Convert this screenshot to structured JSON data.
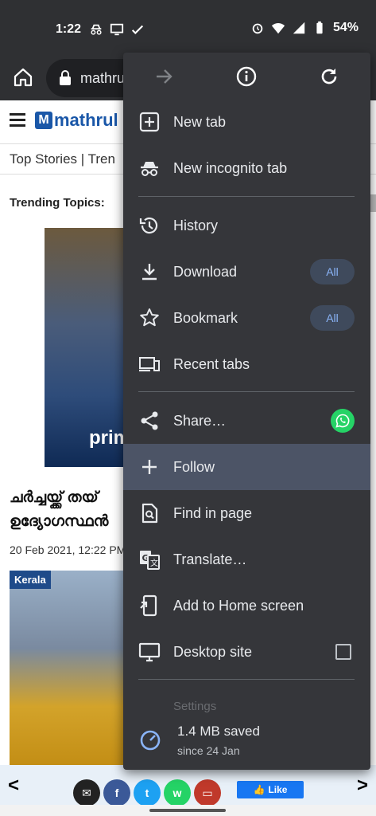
{
  "status_bar": {
    "time": "1:22",
    "battery": "54%"
  },
  "browser": {
    "url": "mathru"
  },
  "page": {
    "logo_text": "mathrul",
    "logo_letter": "M",
    "nav": "Top Stories | Tren",
    "trending": "Trending Topics:",
    "prime_text": "prim",
    "headline_line1": "ചർച്ചയ്ക്ക് തയ്",
    "headline_line2": "ഉദ്യോഗസ്ഥൻ",
    "date": "20 Feb 2021, 12:22 PM",
    "tag": "Kerala"
  },
  "menu": {
    "items": {
      "new_tab": "New tab",
      "incognito": "New incognito tab",
      "history": "History",
      "download": "Download",
      "bookmark": "Bookmark",
      "recent_tabs": "Recent tabs",
      "share": "Share…",
      "follow": "Follow",
      "find": "Find in page",
      "translate": "Translate…",
      "add_home": "Add to Home screen",
      "desktop": "Desktop site",
      "settings": "Settings"
    },
    "chip_all": "All",
    "saved_line1": "1.4 MB saved",
    "saved_line2": "since 24 Jan"
  },
  "share_bar": {
    "like": "Like"
  }
}
